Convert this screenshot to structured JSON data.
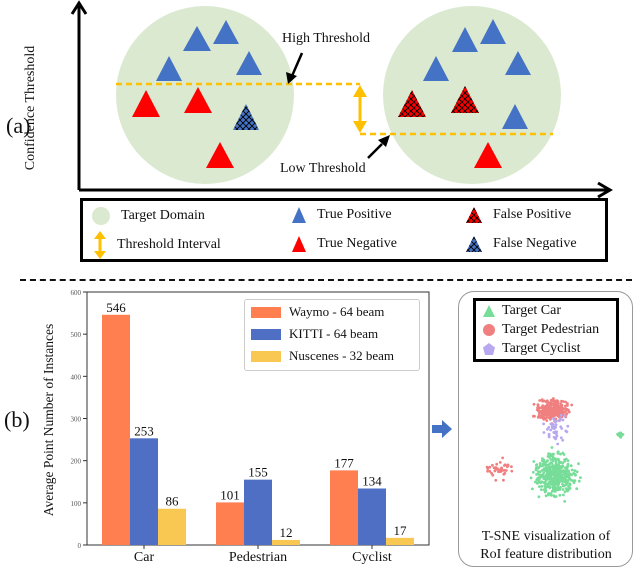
{
  "panel_a": {
    "label": "(a)",
    "y_axis_label": "Confidence  Threshold",
    "high_threshold_label": "High Threshold",
    "low_threshold_label": "Low Threshold",
    "colors": {
      "target_domain": "#dbe9d0",
      "true_positive": "#4472c4",
      "true_negative": "#ff0000",
      "threshold": "#ffc000"
    },
    "legend": [
      {
        "icon": "target-domain-circle",
        "label": "Target Domain"
      },
      {
        "icon": "true-positive-triangle",
        "label": "True Positive"
      },
      {
        "icon": "false-positive-triangle",
        "label": "False Positive"
      },
      {
        "icon": "threshold-interval-arrow",
        "label": "Threshold Interval"
      },
      {
        "icon": "true-negative-triangle",
        "label": "True Negative"
      },
      {
        "icon": "false-negative-triangle",
        "label": "False Negative"
      }
    ]
  },
  "panel_b": {
    "label": "(b)",
    "tsne": {
      "legend": [
        {
          "icon": "triangle",
          "label": "Target Car",
          "color": "#77dd99"
        },
        {
          "icon": "circle",
          "label": "Target Pedestrian",
          "color": "#f08080"
        },
        {
          "icon": "pentagon",
          "label": "Target  Cyclist",
          "color": "#b8a8f0"
        }
      ],
      "caption_line1": "T-SNE visualization of",
      "caption_line2": "RoI feature distribution"
    }
  },
  "chart_data": {
    "type": "bar",
    "title": "",
    "xlabel": "",
    "ylabel": "Average Point Number of Instances",
    "categories": [
      "Car",
      "Pedestrian",
      "Cyclist"
    ],
    "series": [
      {
        "name": "Waymo - 64 beam",
        "values": [
          546,
          101,
          177
        ],
        "color": "#ff7f50"
      },
      {
        "name": "KITTI - 64 beam",
        "values": [
          253,
          155,
          134
        ],
        "color": "#4f6fc4"
      },
      {
        "name": "Nuscenes - 32 beam",
        "values": [
          86,
          12,
          17
        ],
        "color": "#f9c852"
      }
    ],
    "ylim": [
      0,
      600
    ],
    "yticks": [
      0,
      100,
      200,
      300,
      400,
      500,
      600
    ],
    "grid": false,
    "legend_position": "top-right"
  }
}
